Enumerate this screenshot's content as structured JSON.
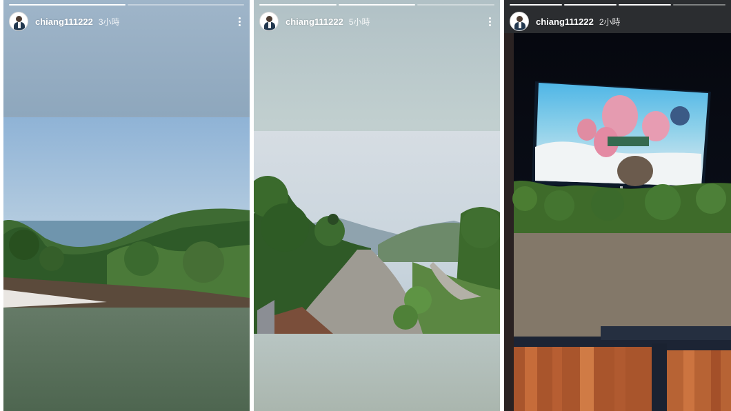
{
  "stories": [
    {
      "username": "chiang111222",
      "time": "3小時",
      "progress": [
        1.0,
        0.0
      ],
      "photo": "sea-mountain-view"
    },
    {
      "username": "chiang111222",
      "time": "5小時",
      "progress": [
        1.0,
        1.0,
        0.0
      ],
      "photo": "mountain-road-view"
    },
    {
      "username": "chiang111222",
      "time": "2小時",
      "progress": [
        1.0,
        1.0,
        1.0,
        0.0
      ],
      "photo": "outdoor-movie-screen"
    }
  ],
  "colors": {
    "text": "#ffffff",
    "progress_track": "rgba(255,255,255,0.4)",
    "progress_fill": "#ffffff"
  },
  "icons": [
    "avatar",
    "more-options-icon"
  ]
}
